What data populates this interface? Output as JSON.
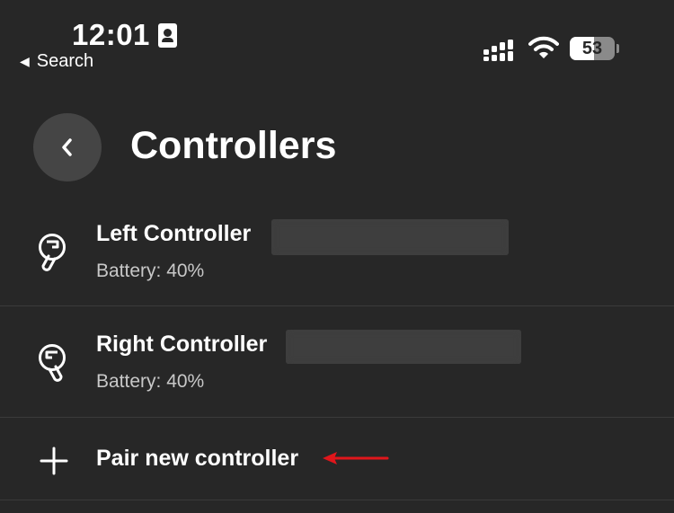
{
  "status_bar": {
    "time": "12:01",
    "back_app": "Search",
    "battery_percent": 53,
    "battery_label": "53"
  },
  "header": {
    "title": "Controllers"
  },
  "controllers": [
    {
      "name": "Left Controller",
      "battery": "Battery: 40%",
      "icon": "left-controller-icon"
    },
    {
      "name": "Right Controller",
      "battery": "Battery: 40%",
      "icon": "right-controller-icon"
    }
  ],
  "pair": {
    "label": "Pair new controller",
    "icon": "plus-icon"
  },
  "colors": {
    "background": "#272727",
    "text": "#ffffff",
    "secondary_text": "#c8c8c8",
    "button_bg": "#454545",
    "annotation_arrow": "#e0161b"
  }
}
